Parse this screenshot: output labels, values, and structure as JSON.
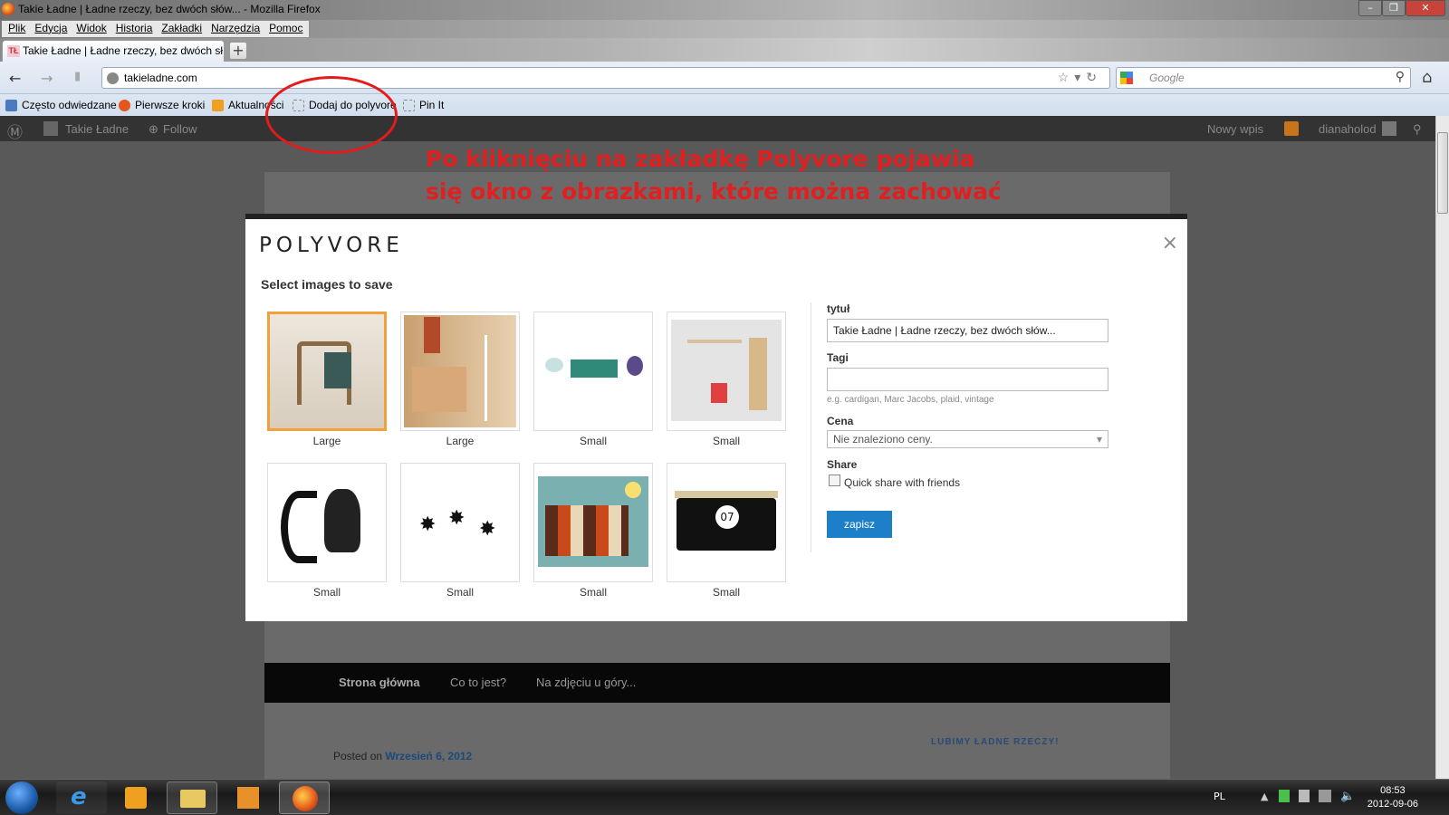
{
  "window": {
    "title": "Takie Ładne | Ładne rzeczy, bez dwóch słów... - Mozilla Firefox",
    "controls": {
      "minimize": "–",
      "maximize": "❐",
      "close": "✕"
    }
  },
  "menu": [
    "Plik",
    "Edycja",
    "Widok",
    "Historia",
    "Zakładki",
    "Narzędzia",
    "Pomoc"
  ],
  "tab": {
    "label": "Takie Ładne | Ładne rzeczy, bez dwóch sł...",
    "favicon": "TŁ",
    "new_tab": "+"
  },
  "nav": {
    "url": "takieladne.com",
    "search_placeholder": "Google",
    "back_icon": "arrow-left-icon",
    "forward_icon": "arrow-right-icon",
    "home_icon": "home-icon"
  },
  "bookmarks": [
    "Często odwiedzane",
    "Pierwsze kroki",
    "Aktualności",
    "Dodaj do polyvore",
    "Pin It"
  ],
  "wpbar": {
    "site": "Takie Ładne",
    "follow": "Follow",
    "new_post": "Nowy wpis",
    "user": "dianaholod"
  },
  "annotation": {
    "line1": "Po kliknięciu na zakładkę Polyvore pojawia",
    "line2": "się okno z obrazkami, które można zachować",
    "color": "#e02020"
  },
  "modal": {
    "logo": "POLYVORE",
    "close": "×",
    "heading": "Select images to save",
    "images": [
      {
        "caption": "Large",
        "selected": true
      },
      {
        "caption": "Large",
        "selected": false
      },
      {
        "caption": "Small",
        "selected": false
      },
      {
        "caption": "Small",
        "selected": false
      },
      {
        "caption": "Small",
        "selected": false
      },
      {
        "caption": "Small",
        "selected": false
      },
      {
        "caption": "Small",
        "selected": false
      },
      {
        "caption": "Small",
        "selected": false
      }
    ],
    "form": {
      "title_label": "tytuł",
      "title_value": "Takie Ładne | Ładne rzeczy, bez dwóch słów...",
      "tags_label": "Tagi",
      "tags_hint": "e.g. cardigan, Marc Jacobs, plaid, vintage",
      "price_label": "Cena",
      "price_value": "Nie znaleziono ceny.",
      "share_label": "Share",
      "share_option": "Quick share with friends",
      "save": "zapisz"
    }
  },
  "site_nav": [
    "Strona główna",
    "Co to jest?",
    "Na zdjęciu u góry..."
  ],
  "posted": {
    "prefix": "Posted on",
    "date": "Wrzesień 6, 2012"
  },
  "sidebar_heading": "LUBIMY ŁADNE RZECZY!",
  "taskbar": {
    "lang": "PL",
    "time": "08:53",
    "date": "2012-09-06"
  }
}
